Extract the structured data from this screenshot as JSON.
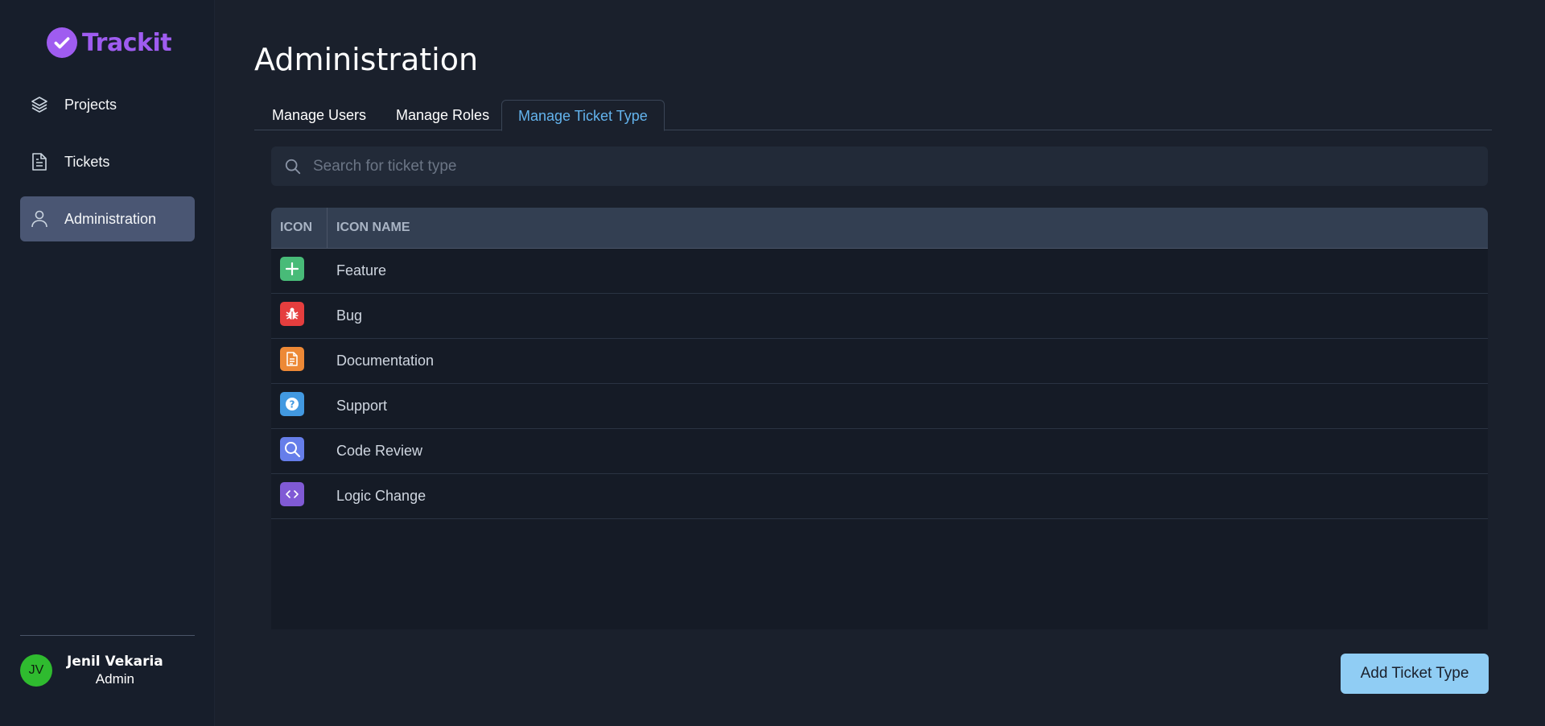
{
  "app": {
    "name": "Trackit",
    "brand_color": "#9f5cf0"
  },
  "sidebar": {
    "items": [
      {
        "label": "Projects",
        "icon": "layers-icon",
        "active": false
      },
      {
        "label": "Tickets",
        "icon": "document-icon",
        "active": false
      },
      {
        "label": "Administration",
        "icon": "user-icon",
        "active": true
      }
    ]
  },
  "user": {
    "initials": "JV",
    "name": "Jenil Vekaria",
    "role": "Admin",
    "avatar_color": "#2fbb2f"
  },
  "page": {
    "title": "Administration"
  },
  "tabs": [
    {
      "label": "Manage Users",
      "active": false
    },
    {
      "label": "Manage Roles",
      "active": false
    },
    {
      "label": "Manage Ticket Type",
      "active": true
    }
  ],
  "search": {
    "placeholder": "Search for ticket type",
    "value": ""
  },
  "table": {
    "columns": [
      "ICON",
      "ICON NAME"
    ],
    "rows": [
      {
        "name": "Feature",
        "icon": "plus-icon",
        "color": "#48bb78"
      },
      {
        "name": "Bug",
        "icon": "bug-icon",
        "color": "#e53e3e"
      },
      {
        "name": "Documentation",
        "icon": "document-icon",
        "color": "#ed8936"
      },
      {
        "name": "Support",
        "icon": "question-icon",
        "color": "#4299e1"
      },
      {
        "name": "Code Review",
        "icon": "search-icon",
        "color": "#667eea"
      },
      {
        "name": "Logic Change",
        "icon": "code-icon",
        "color": "#805ad5"
      }
    ]
  },
  "actions": {
    "add_label": "Add Ticket Type"
  }
}
